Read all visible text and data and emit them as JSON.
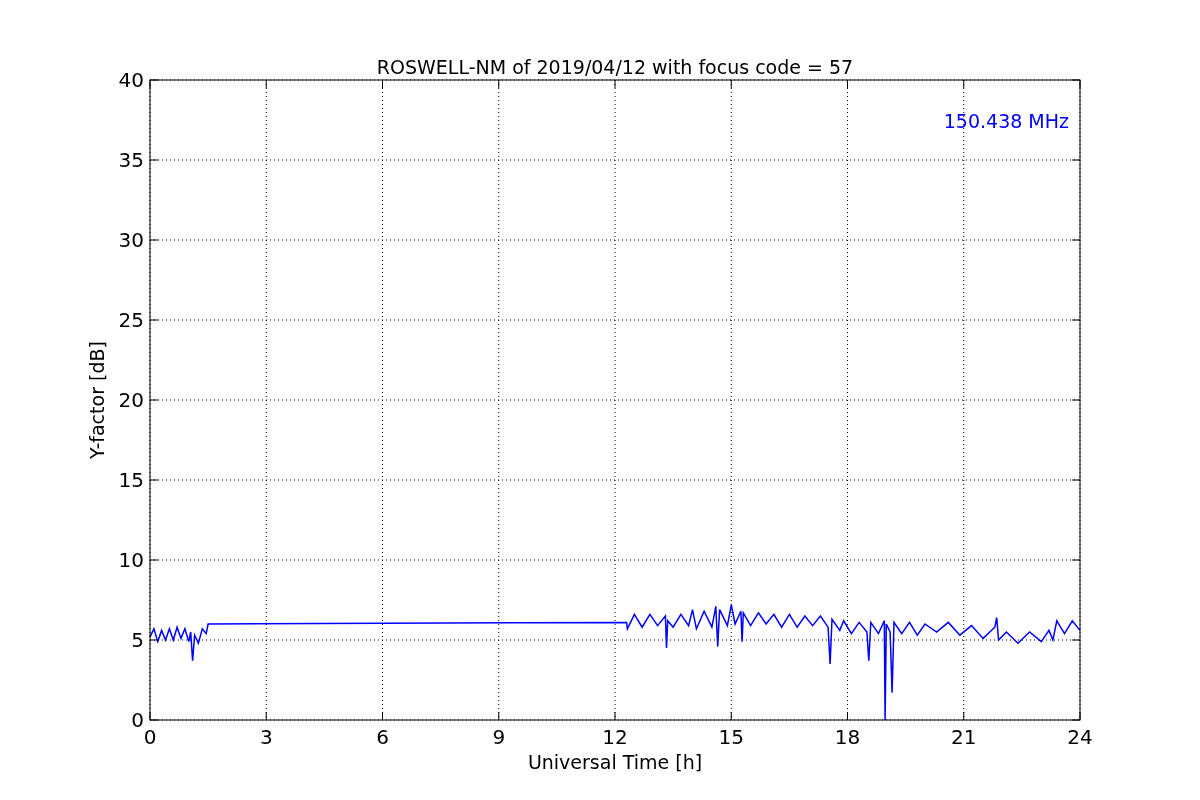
{
  "figure": {
    "chart_data": {
      "type": "line",
      "title": "ROSWELL-NM of 2019/04/12 with focus code = 57",
      "xlabel": "Universal Time [h]",
      "ylabel": "Y-factor [dB]",
      "xlim": [
        0,
        24
      ],
      "ylim": [
        0,
        40
      ],
      "xticks": [
        0,
        3,
        6,
        9,
        12,
        15,
        18,
        21,
        24
      ],
      "yticks": [
        0,
        5,
        10,
        15,
        20,
        25,
        30,
        35,
        40
      ],
      "x": [
        0,
        0.1,
        0.2,
        0.3,
        0.4,
        0.5,
        0.6,
        0.7,
        0.8,
        0.9,
        1.0,
        1.05,
        1.1,
        1.15,
        1.25,
        1.35,
        1.45,
        1.5,
        12.3,
        12.32,
        12.5,
        12.7,
        12.9,
        13.1,
        13.3,
        13.33,
        13.36,
        13.5,
        13.7,
        13.9,
        14.0,
        14.1,
        14.3,
        14.5,
        14.6,
        14.65,
        14.7,
        14.9,
        15.0,
        15.1,
        15.25,
        15.28,
        15.31,
        15.5,
        15.7,
        15.9,
        16.1,
        16.3,
        16.5,
        16.7,
        16.9,
        17.1,
        17.3,
        17.5,
        17.55,
        17.6,
        17.8,
        17.9,
        18.1,
        18.3,
        18.5,
        18.55,
        18.6,
        18.8,
        18.95,
        18.97,
        19.0,
        19.1,
        19.15,
        19.2,
        19.4,
        19.6,
        19.8,
        20.0,
        20.3,
        20.6,
        20.9,
        21.2,
        21.5,
        21.8,
        21.85,
        21.9,
        22.1,
        22.4,
        22.7,
        23.0,
        23.2,
        23.3,
        23.4,
        23.6,
        23.8,
        24.0
      ],
      "series": [
        {
          "name": "150.438 MHz",
          "color": "#0000ff",
          "values": [
            5.2,
            5.7,
            4.9,
            5.6,
            5.0,
            5.7,
            5.0,
            5.8,
            5.1,
            5.7,
            4.9,
            5.5,
            3.7,
            5.3,
            4.8,
            5.7,
            5.4,
            6.0,
            6.1,
            5.7,
            6.6,
            5.8,
            6.6,
            5.9,
            6.5,
            4.5,
            6.2,
            5.8,
            6.6,
            5.9,
            6.9,
            5.7,
            6.8,
            5.8,
            7.1,
            4.6,
            6.9,
            5.9,
            7.2,
            6.0,
            6.8,
            4.9,
            6.7,
            5.9,
            6.7,
            6.0,
            6.6,
            5.8,
            6.6,
            5.8,
            6.5,
            5.9,
            6.5,
            5.8,
            3.5,
            6.3,
            5.6,
            6.2,
            5.4,
            6.1,
            5.5,
            3.7,
            6.1,
            5.4,
            6.2,
            0,
            6.0,
            5.5,
            1.7,
            6.1,
            5.4,
            6.1,
            5.3,
            6.0,
            5.5,
            6.1,
            5.3,
            5.9,
            5.1,
            5.8,
            6.4,
            5.0,
            5.5,
            4.8,
            5.5,
            4.9,
            5.6,
            5.0,
            6.2,
            5.4,
            6.2,
            5.6
          ]
        }
      ],
      "grid": true
    }
  }
}
